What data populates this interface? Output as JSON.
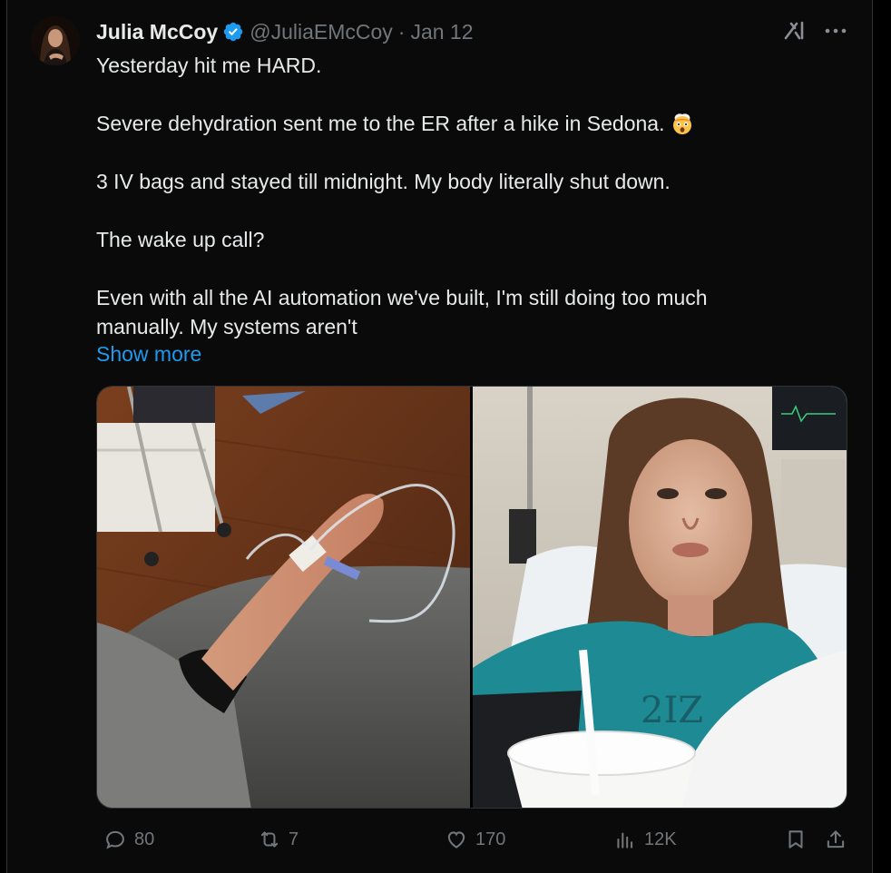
{
  "author": {
    "name": "Julia McCoy",
    "handle": "@JuliaEMcCoy",
    "separator": "·",
    "date": "Jan 12",
    "verified": true
  },
  "tweet": {
    "lines": [
      "Yesterday hit me HARD.",
      "",
      "Severe dehydration sent me to the ER after a hike in Sedona.",
      "",
      "3 IV bags and stayed till midnight. My body literally shut down.",
      "",
      "The wake up call?",
      "",
      "Even with all the AI automation we've built, I'm still doing too much",
      "manually. My systems aren't"
    ],
    "emoji": "exploding-head",
    "show_more": "Show more"
  },
  "media": {
    "count": 2,
    "photos": [
      "iv-arm-photo",
      "hospital-selfie-photo"
    ]
  },
  "actions": {
    "replies": "80",
    "reposts": "7",
    "likes": "170",
    "views": "12K"
  },
  "colors": {
    "background": "#000000",
    "text": "#e7e9ea",
    "secondary": "#71767b",
    "link": "#1d9bf0",
    "verified": "#1d9bf0"
  }
}
